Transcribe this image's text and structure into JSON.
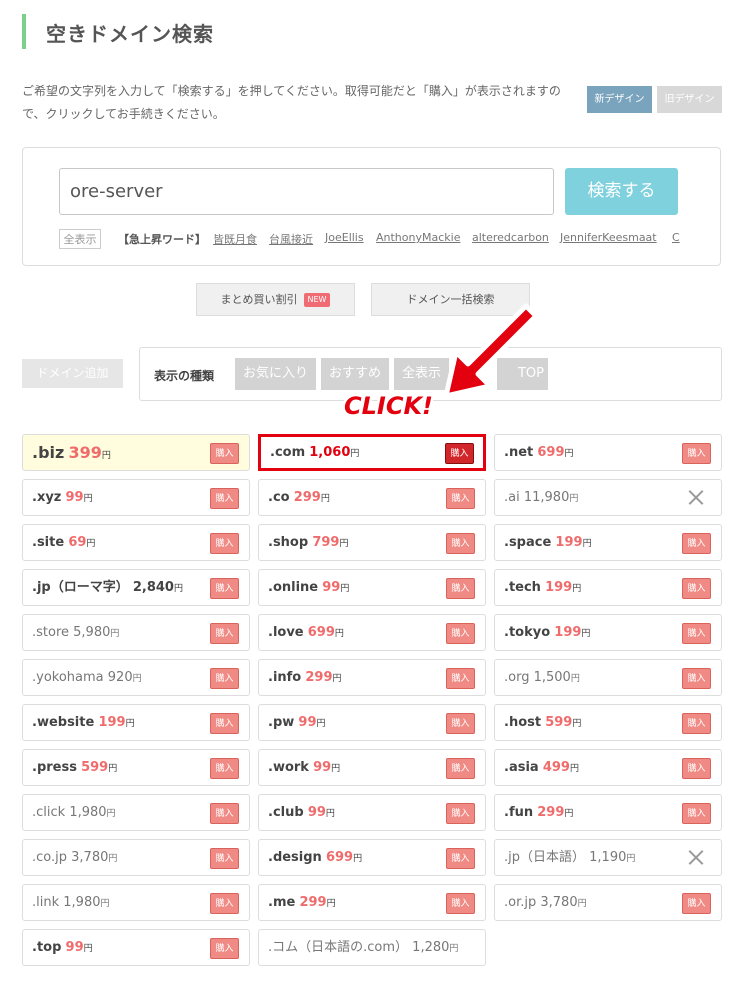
{
  "page_title": "空きドメイン検索",
  "description": "ご希望の文字列を入力して「検索する」を押してください。取得可能だと「購入」が表示されますので、クリックしてお手続きください。",
  "design_buttons": {
    "new": "新デザイン",
    "old": "旧デザイン"
  },
  "search": {
    "value": "ore-server",
    "button": "検索する",
    "show_all": "全表示"
  },
  "trending": {
    "label": "【急上昇ワード】",
    "words": [
      "皆既月食",
      "台風接近",
      "JoeEllis",
      "AnthonyMackie",
      "alteredcarbon",
      "JenniferKeesmaat",
      "C"
    ]
  },
  "mid_buttons": {
    "bulk_discount": "まとめ買い割引",
    "new_badge": "NEW",
    "bulk_search": "ドメイン一括検索"
  },
  "add_domain": "ドメイン追加",
  "filter": {
    "label": "表示の種類",
    "tabs": [
      "お気に入り",
      "おすすめ",
      "全表示",
      "TOP"
    ]
  },
  "annotation": {
    "text": "CLICK!",
    "arrow_color": "#e3000f"
  },
  "buy_label": "購入",
  "yen": "円",
  "domains": [
    {
      "name": ".biz",
      "price": "399",
      "available": true,
      "style": "highlight"
    },
    {
      "name": ".com",
      "price": "1,060",
      "available": true,
      "style": "clicked"
    },
    {
      "name": ".net",
      "price": "699",
      "available": true
    },
    {
      "name": ".xyz",
      "price": "99",
      "available": true
    },
    {
      "name": ".co",
      "price": "299",
      "available": true
    },
    {
      "name": ".ai",
      "price": "11,980",
      "available": false
    },
    {
      "name": ".site",
      "price": "69",
      "available": true
    },
    {
      "name": ".shop",
      "price": "799",
      "available": true
    },
    {
      "name": ".space",
      "price": "199",
      "available": true
    },
    {
      "name": ".jp（ローマ字）",
      "price": "2,840",
      "available": true,
      "style": "bold-dark"
    },
    {
      "name": ".online",
      "price": "99",
      "available": true
    },
    {
      "name": ".tech",
      "price": "199",
      "available": true
    },
    {
      "name": ".store",
      "price": "5,980",
      "available": true,
      "style": "plain"
    },
    {
      "name": ".love",
      "price": "699",
      "available": true
    },
    {
      "name": ".tokyo",
      "price": "199",
      "available": true
    },
    {
      "name": ".yokohama",
      "price": "920",
      "available": true,
      "style": "plain"
    },
    {
      "name": ".info",
      "price": "299",
      "available": true
    },
    {
      "name": ".org",
      "price": "1,500",
      "available": true,
      "style": "plain"
    },
    {
      "name": ".website",
      "price": "199",
      "available": true
    },
    {
      "name": ".pw",
      "price": "99",
      "available": true
    },
    {
      "name": ".host",
      "price": "599",
      "available": true
    },
    {
      "name": ".press",
      "price": "599",
      "available": true
    },
    {
      "name": ".work",
      "price": "99",
      "available": true
    },
    {
      "name": ".asia",
      "price": "499",
      "available": true
    },
    {
      "name": ".click",
      "price": "1,980",
      "available": true,
      "style": "plain"
    },
    {
      "name": ".club",
      "price": "99",
      "available": true
    },
    {
      "name": ".fun",
      "price": "299",
      "available": true
    },
    {
      "name": ".co.jp",
      "price": "3,780",
      "available": true,
      "style": "plain"
    },
    {
      "name": ".design",
      "price": "699",
      "available": true
    },
    {
      "name": ".jp（日本語）",
      "price": "1,190",
      "available": false
    },
    {
      "name": ".link",
      "price": "1,980",
      "available": true,
      "style": "plain"
    },
    {
      "name": ".me",
      "price": "299",
      "available": true
    },
    {
      "name": ".or.jp",
      "price": "3,780",
      "available": true,
      "style": "plain"
    },
    {
      "name": ".top",
      "price": "99",
      "available": true
    },
    {
      "name": ".コム（日本語の.com）",
      "price": "1,280",
      "available": false,
      "style": "plain-nobtn"
    }
  ]
}
